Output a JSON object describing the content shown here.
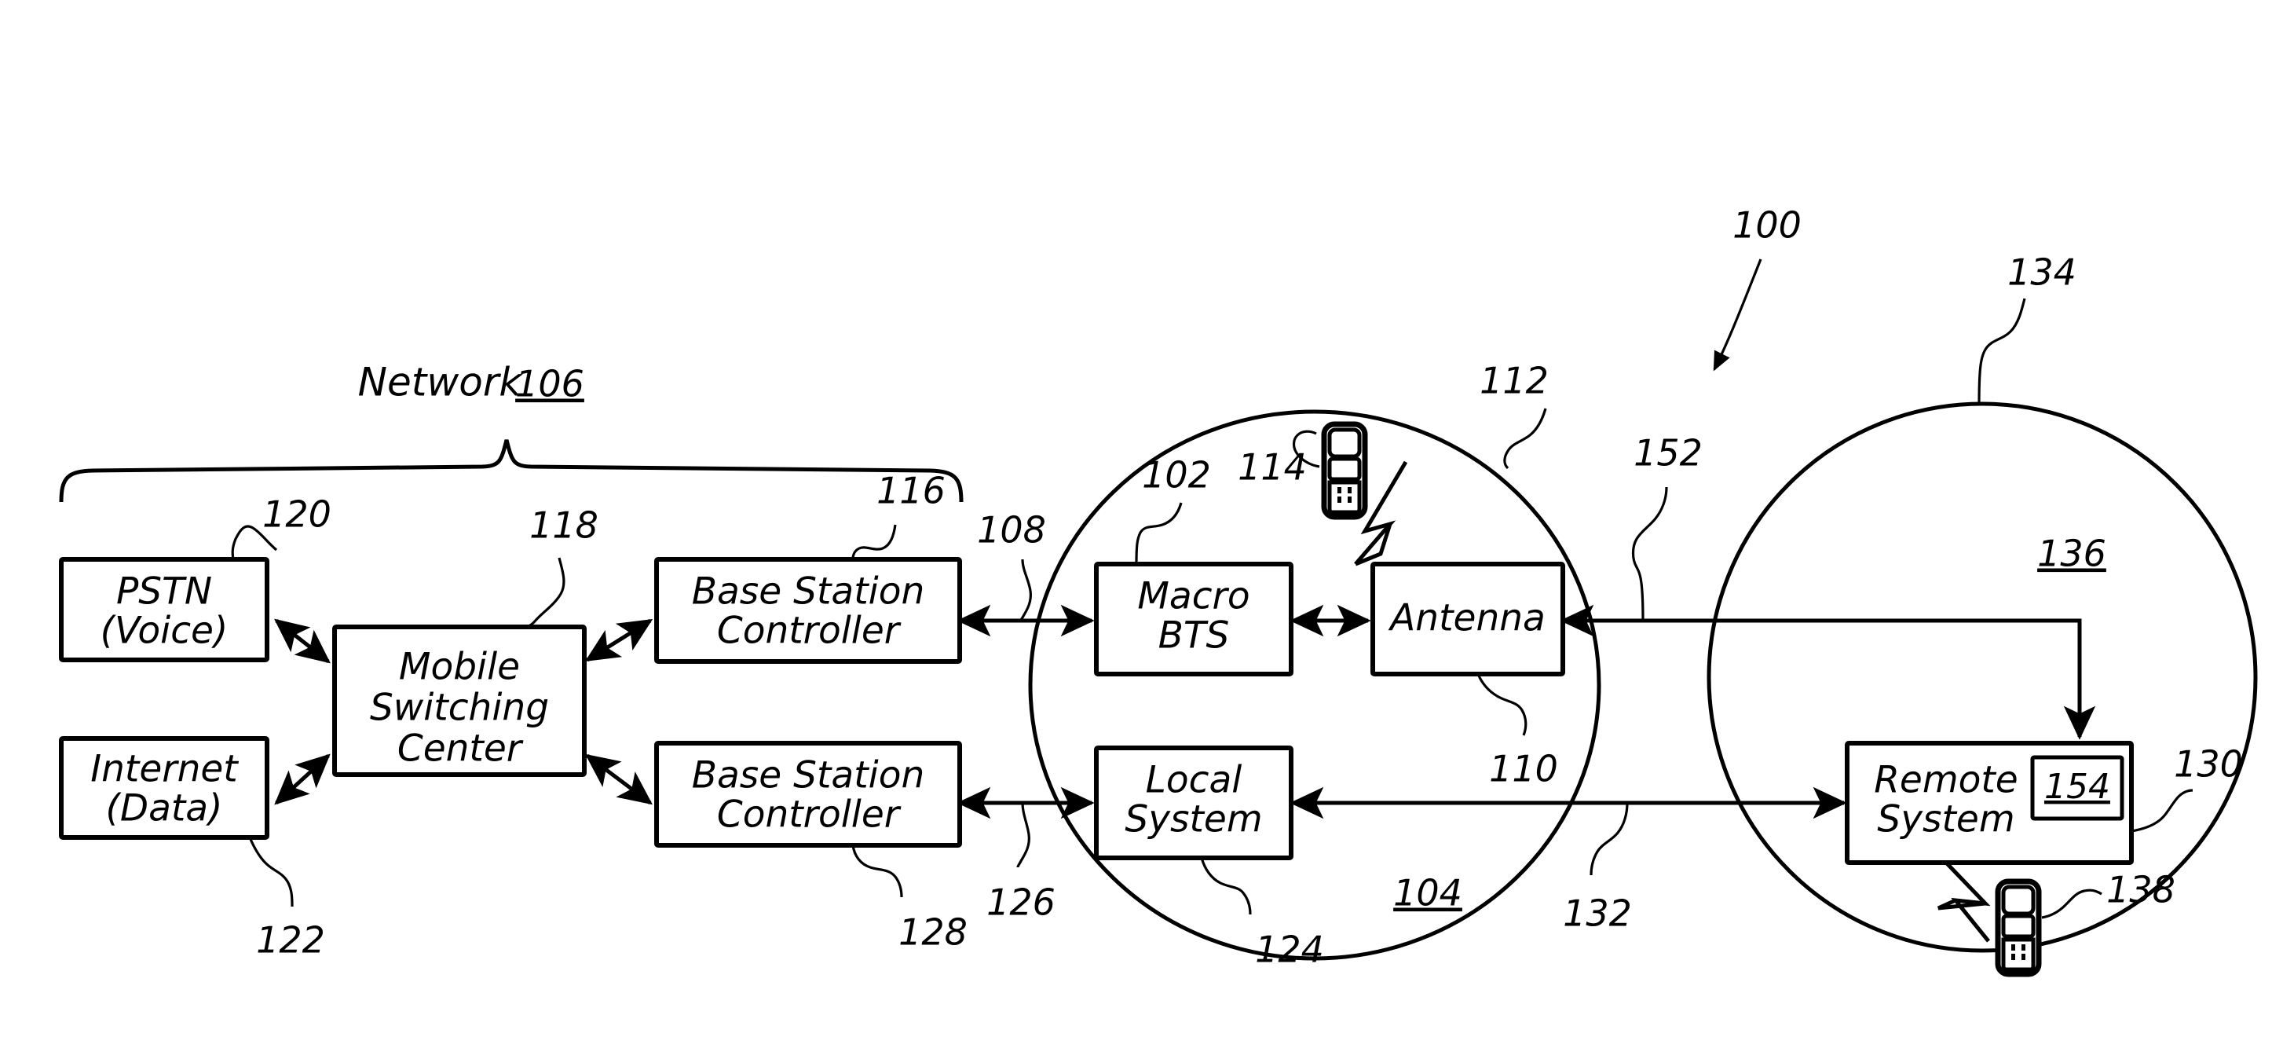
{
  "figure": {
    "type": "patent-diagram",
    "title_ref": "100",
    "group_label": {
      "text": "Network",
      "ref": "106"
    },
    "boxes": [
      {
        "id": "pstn",
        "line1": "PSTN",
        "line2": "(Voice)",
        "ref": "120"
      },
      {
        "id": "internet",
        "line1": "Internet",
        "line2": "(Data)",
        "ref": "122"
      },
      {
        "id": "msc",
        "line1": "Mobile",
        "line2": "Switching",
        "line3": "Center",
        "ref": "118"
      },
      {
        "id": "bsc1",
        "line1": "Base  Station",
        "line2": "Controller",
        "ref": "116"
      },
      {
        "id": "bsc2",
        "line1": "Base  Station",
        "line2": "Controller",
        "ref": "128"
      },
      {
        "id": "macro",
        "line1": "Macro",
        "line2": "BTS",
        "ref": "102"
      },
      {
        "id": "antenna",
        "line1": "Antenna",
        "line2": "",
        "ref": "110"
      },
      {
        "id": "local",
        "line1": "Local",
        "line2": "System",
        "ref": "124"
      },
      {
        "id": "remote",
        "line1": "Remote",
        "line2": "System",
        "ref": "130",
        "inner_ref": "154"
      }
    ],
    "cells": [
      {
        "id": "local-cell",
        "ref": "112",
        "inner_ref": "104"
      },
      {
        "id": "remote-cell",
        "ref": "134",
        "inner_ref": "136"
      }
    ],
    "links": [
      {
        "id": "bsc1-macro",
        "ref": "108"
      },
      {
        "id": "bsc2-local",
        "ref": "126"
      },
      {
        "id": "antenna-remote",
        "ref": "152"
      },
      {
        "id": "local-remote",
        "ref": "132"
      }
    ],
    "mobiles": [
      {
        "id": "mobile-local",
        "ref": "114"
      },
      {
        "id": "mobile-remote",
        "ref": "138"
      }
    ],
    "ref_numbers": {
      "system": "100",
      "macro_bts": "102",
      "local_cell_inner": "104",
      "network": "106",
      "link_108": "108",
      "antenna": "110",
      "local_cell": "112",
      "mobile_114": "114",
      "bsc1": "116",
      "msc": "118",
      "pstn": "120",
      "internet": "122",
      "local_system": "124",
      "link_126": "126",
      "bsc2": "128",
      "remote_system": "130",
      "link_132": "132",
      "remote_cell": "134",
      "remote_cell_inner": "136",
      "mobile_138": "138",
      "link_152": "152",
      "remote_inner_154": "154"
    },
    "colors": {
      "ink": "#000000",
      "paper": "#ffffff"
    }
  }
}
